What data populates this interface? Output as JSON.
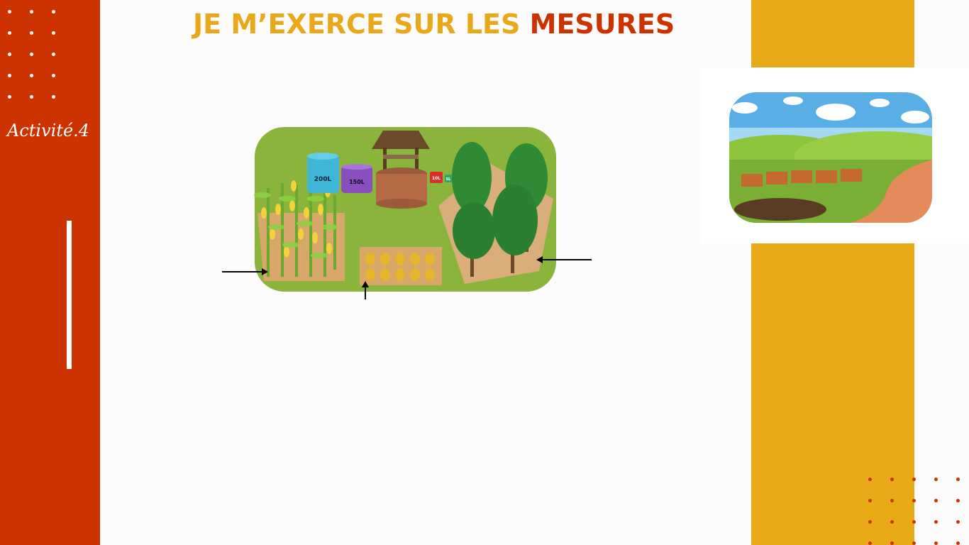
{
  "slide": {
    "title_part1": "JE M’EXERCE SUR LES ",
    "title_part2": "MESURES",
    "activity_label": "Activité.4"
  },
  "farm_scene": {
    "barrel_large_label": "200L",
    "barrel_medium_label": "150L",
    "bucket_small_label": "10L",
    "bucket_tiny_label": "5L"
  },
  "colors": {
    "sidebar_red": "#cc3300",
    "accent_gold": "#e8aa16",
    "title_gold": "#e8a81a",
    "grass_green": "#8bb43c"
  }
}
